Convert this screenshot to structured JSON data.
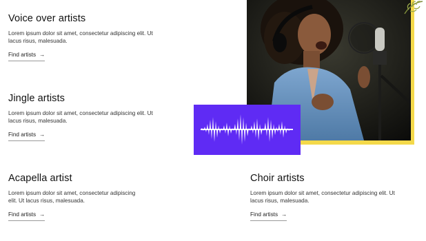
{
  "cards": {
    "voice": {
      "title": "Voice over artists",
      "desc": "Lorem ipsum dolor sit amet, consectetur adipiscing elit. Ut lacus risus, malesuada.",
      "link": "Find artists"
    },
    "jingle": {
      "title": "Jingle artists",
      "desc": "Lorem ipsum dolor sit amet, consectetur adipiscing elit. Ut lacus risus, malesuada.",
      "link": "Find artists"
    },
    "acapella": {
      "title": "Acapella artist",
      "desc": "Lorem ipsum dolor sit amet, consectetur adipiscing elit. Ut lacus risus, malesuada.",
      "link": "Find artists"
    },
    "choir": {
      "title": "Choir artists",
      "desc": "Lorem ipsum dolor sit amet, consectetur adipiscing elit. Ut lacus risus, malesuada.",
      "link": "Find artists"
    }
  },
  "icons": {
    "link_arrow": "arrow-right-icon",
    "waveform": "waveform-icon",
    "leaf": "leaf-icon"
  },
  "colors": {
    "accent_purple": "#5f2bf4",
    "frame_yellow": "#f4d94a",
    "text": "#111111"
  }
}
